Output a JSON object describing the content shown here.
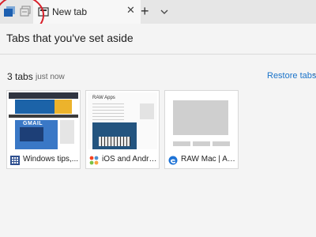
{
  "tab_strip": {
    "icons": [
      "set-aside-tabs-icon",
      "restore-set-aside-tabs-icon"
    ],
    "active_tab": {
      "title": "New tab",
      "favicon": "new-tab-page-icon",
      "close_icon": "close-icon"
    },
    "new_tab_symbol": "+",
    "tab_list_icon": "chevron-down-icon"
  },
  "annotation": {
    "shape": "circle",
    "color": "#d8202a"
  },
  "panel": {
    "heading": "Tabs that you've set aside",
    "group": {
      "count": "3 tabs",
      "when": "just now",
      "restore_label": "Restore tabs",
      "more": "·"
    },
    "cards": [
      {
        "label": "Windows tips,...",
        "favicon": "grid-app-icon",
        "thumb_text": "GMAIL"
      },
      {
        "label": "iOS and Androi...",
        "favicon": "joomla-icon",
        "thumb_text": "RAW Apps"
      },
      {
        "label": "RAW Mac | App...",
        "favicon": "edge-icon"
      }
    ]
  },
  "colors": {
    "accent": "#1a73c9",
    "tab_bg": "#e6e6e6",
    "panel_bg": "#f4f4f4"
  }
}
